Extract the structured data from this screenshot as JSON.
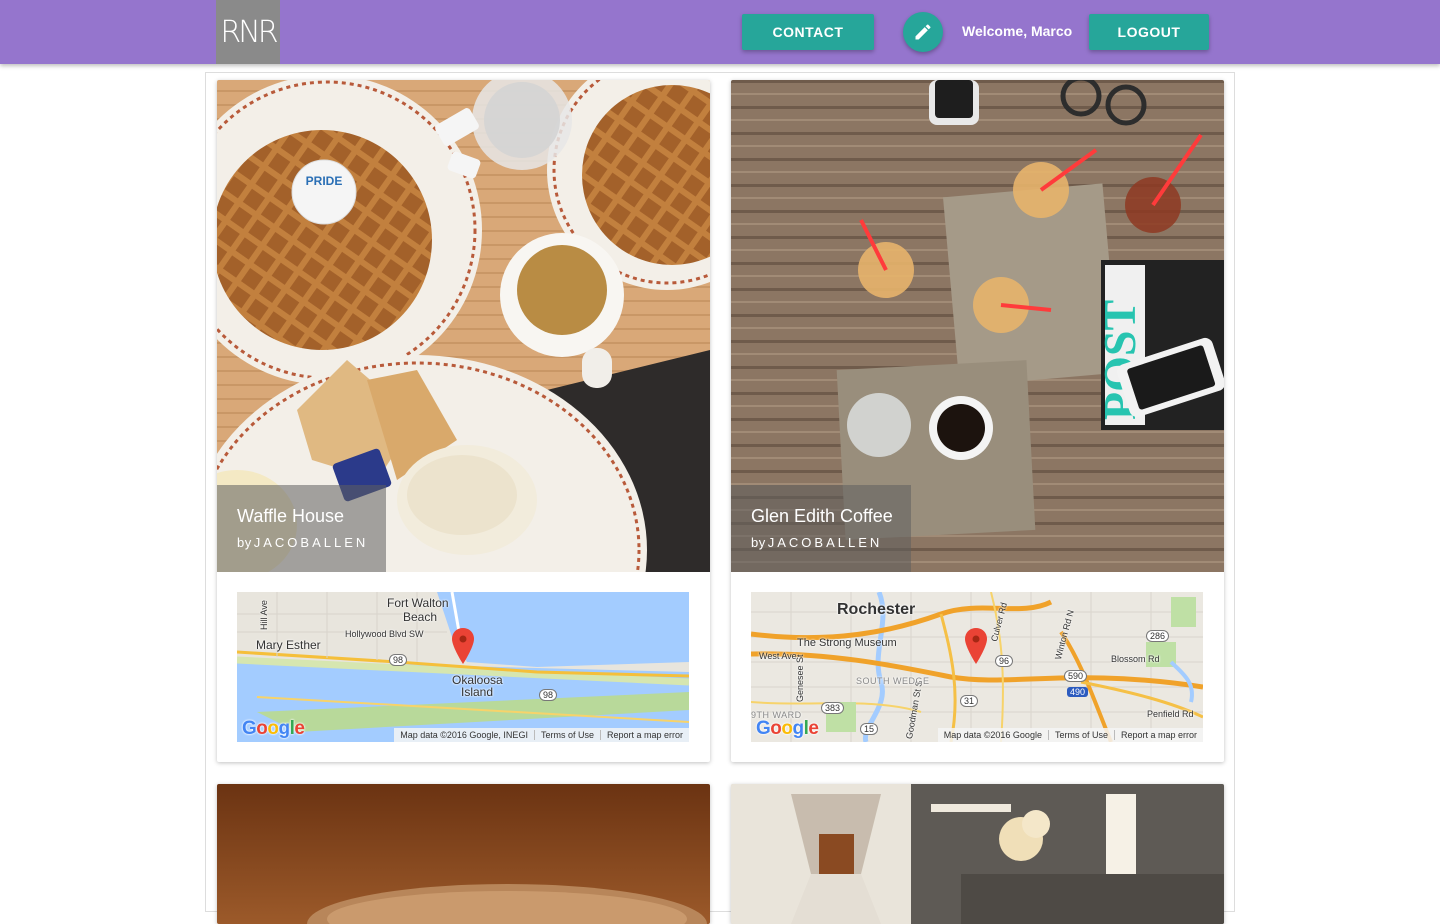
{
  "header": {
    "logo_text": "RNR",
    "contact_label": "CONTACT",
    "welcome_text": "Welcome, Marco",
    "logout_label": "LOGOUT",
    "edit_icon": "pencil-icon",
    "colors": {
      "bar": "#9575cd",
      "accent": "#26a69a"
    }
  },
  "cards": [
    {
      "title": "Waffle House",
      "by_prefix": "by",
      "author": "JACOBALLEN",
      "map": {
        "labels": {
          "city1": "Fort Walton",
          "city1b": "Beach",
          "city2": "Mary Esther",
          "city3": "Okaloosa",
          "city3b": "Island",
          "road1": "Hollywood Blvd SW",
          "road2": "Hill Ave",
          "shield1": "98",
          "shield2": "98"
        },
        "attribution": "Map data ©2016 Google, INEGI",
        "terms": "Terms of Use",
        "report": "Report a map error",
        "logo": "Google"
      }
    },
    {
      "title": "Glen Edith Coffee",
      "by_prefix": "by",
      "author": "JACOBALLEN",
      "map": {
        "labels": {
          "city1": "Rochester",
          "poi": "The Strong Museum",
          "road1": "West Ave",
          "road2": "Culver Rd",
          "road3": "Winton Rd N",
          "road4": "Blossom Rd",
          "road5": "Penfield Rd",
          "road6": "Genesee St",
          "road7": "Goodman St S",
          "area1": "SOUTH WEDGE",
          "area2": "9TH WARD",
          "shield1": "96",
          "shield2": "286",
          "shield3": "590",
          "shield4": "490",
          "shield5": "383",
          "shield6": "31",
          "shield7": "15"
        },
        "attribution": "Map data ©2016 Google",
        "terms": "Terms of Use",
        "report": "Report a map error",
        "logo": "Google"
      }
    }
  ]
}
